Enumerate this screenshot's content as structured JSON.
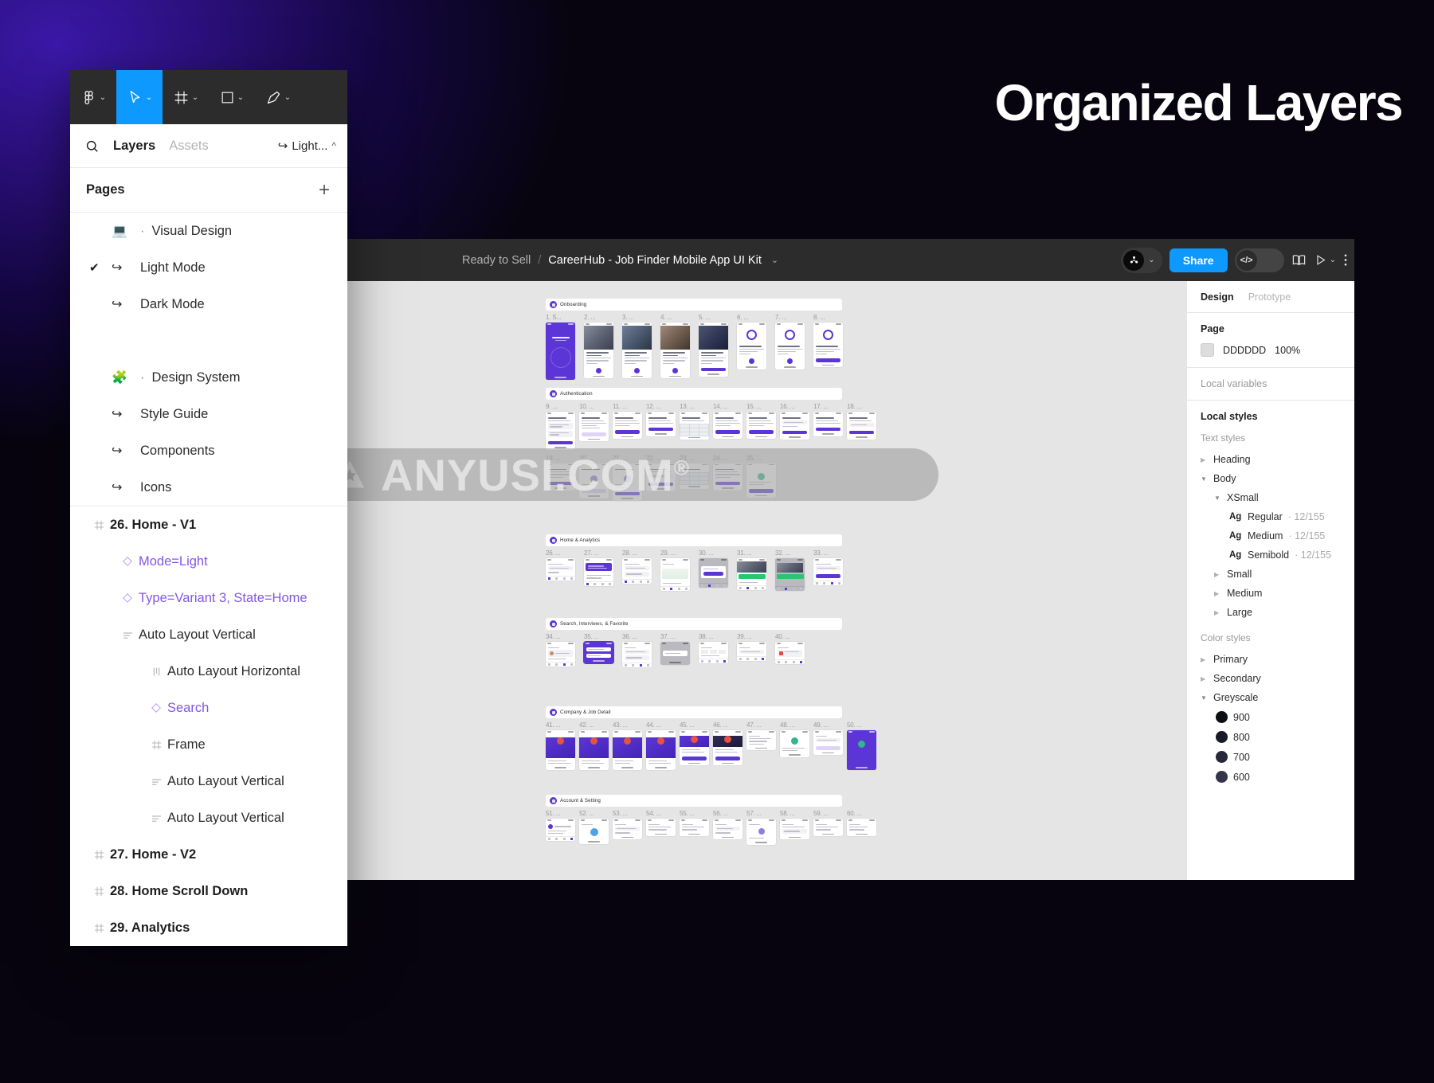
{
  "headline": "Organized Layers",
  "toolbar": {
    "tools": [
      {
        "name": "figma-menu",
        "glyph": "figma",
        "caret": true,
        "active": false
      },
      {
        "name": "move-tool",
        "glyph": "cursor",
        "caret": true,
        "active": true
      },
      {
        "name": "frame-tool",
        "glyph": "frame",
        "caret": true,
        "active": false
      },
      {
        "name": "shape-tool",
        "glyph": "square",
        "caret": true,
        "active": false
      },
      {
        "name": "pen-tool",
        "glyph": "pen",
        "caret": true,
        "active": false
      }
    ]
  },
  "left_panel": {
    "tabs": [
      {
        "label": "Layers",
        "active": true
      },
      {
        "label": "Assets",
        "active": false
      }
    ],
    "search_icon": "search-icon",
    "mode_selector": {
      "label": "Light...",
      "caret": "^"
    },
    "pages_header": {
      "title": "Pages",
      "add_label": "+"
    },
    "pages": [
      {
        "icon": "laptop",
        "dot": "·",
        "label": "Visual Design",
        "checked": false,
        "indent": 0
      },
      {
        "icon": "arrow",
        "label": "Light Mode",
        "checked": true,
        "indent": 1
      },
      {
        "icon": "arrow",
        "label": "Dark Mode",
        "checked": false,
        "indent": 1
      },
      {
        "icon": "puzzle",
        "dot": "·",
        "label": "Design System",
        "checked": false,
        "indent": 0,
        "spacer_before": true
      },
      {
        "icon": "arrow",
        "label": "Style Guide",
        "checked": false,
        "indent": 1
      },
      {
        "icon": "arrow",
        "label": "Components",
        "checked": false,
        "indent": 1
      },
      {
        "icon": "arrow",
        "label": "Icons",
        "checked": false,
        "indent": 1
      }
    ],
    "layers": [
      {
        "label": "26. Home - V1",
        "type": "frame",
        "indent": 0
      },
      {
        "label": "Mode=Light",
        "type": "comp",
        "indent": 1
      },
      {
        "label": "Type=Variant 3, State=Home",
        "type": "comp",
        "indent": 1
      },
      {
        "label": "Auto Layout Vertical",
        "type": "autov",
        "indent": 1
      },
      {
        "label": "Auto Layout Horizontal",
        "type": "autoh",
        "indent": 2
      },
      {
        "label": "Search",
        "type": "comp",
        "indent": 2
      },
      {
        "label": "Frame",
        "type": "frame-sub",
        "indent": 2
      },
      {
        "label": "Auto Layout Vertical",
        "type": "autov",
        "indent": 2
      },
      {
        "label": "Auto Layout Vertical",
        "type": "autov",
        "indent": 2
      },
      {
        "label": "27. Home - V2",
        "type": "frame",
        "indent": 0
      },
      {
        "label": "28. Home Scroll Down",
        "type": "frame",
        "indent": 0
      },
      {
        "label": "29. Analytics",
        "type": "frame",
        "indent": 0
      }
    ]
  },
  "editor": {
    "breadcrumb": {
      "project": "Ready to Sell",
      "separator": "/",
      "file": "CareerHub - Job Finder Mobile App UI Kit",
      "caret": "⌄"
    },
    "actions": {
      "avatar_caret": "⌄",
      "share_label": "Share",
      "code_label": "</>",
      "book_icon": "book-icon",
      "present_icon": "play-icon",
      "present_caret": "⌄"
    }
  },
  "canvas": {
    "sections": [
      {
        "label": "Onboarding",
        "frames": [
          "1. S...",
          "2. ...",
          "3. ...",
          "4. ...",
          "5. ...",
          "6. ...",
          "7. ...",
          "8. ..."
        ]
      },
      {
        "label": "Authentication",
        "frames": [
          "9. ...",
          "10. ...",
          "11. ...",
          "12. ...",
          "13. ...",
          "14. ...",
          "15. ...",
          "16. ...",
          "17. ...",
          "18. ..."
        ],
        "frames2": [
          "19. ...",
          "20. ...",
          "21. ...",
          "22. ...",
          "23. ...",
          "24. ...",
          "25. ..."
        ]
      },
      {
        "label": "Home & Analytics",
        "frames": [
          "26. ...",
          "27. ...",
          "28. ...",
          "29. ...",
          "30. ...",
          "31. ...",
          "32. ...",
          "33. ..."
        ]
      },
      {
        "label": "Search, Interviews, & Favorite",
        "frames": [
          "34. ...",
          "35. ...",
          "36. ...",
          "37. ...",
          "38. ...",
          "39. ...",
          "40. ..."
        ]
      },
      {
        "label": "Company & Job Detail",
        "frames": [
          "41. ...",
          "42. ...",
          "43. ...",
          "44. ...",
          "45. ...",
          "46. ...",
          "47. ...",
          "48. ...",
          "49. ...",
          "50. ..."
        ]
      },
      {
        "label": "Account & Setting",
        "frames": [
          "51. ...",
          "52. ...",
          "53. ...",
          "54. ...",
          "55. ...",
          "56. ...",
          "57. ...",
          "58. ...",
          "59. ...",
          "60. ..."
        ]
      }
    ]
  },
  "right_panel": {
    "tabs": [
      {
        "label": "Design",
        "active": true
      },
      {
        "label": "Prototype",
        "active": false
      }
    ],
    "page_section": {
      "title": "Page",
      "color_hex": "DDDDDD",
      "opacity": "100%",
      "swatch_color": "#dddddd"
    },
    "local_variables_label": "Local variables",
    "local_styles_label": "Local styles",
    "text_styles_label": "Text styles",
    "text_styles": [
      {
        "label": "Heading",
        "indent": 0,
        "state": "collapsed"
      },
      {
        "label": "Body",
        "indent": 0,
        "state": "expanded"
      },
      {
        "label": "XSmall",
        "indent": 1,
        "state": "expanded"
      },
      {
        "label": "Regular",
        "meta": "· 12/155",
        "indent": 2,
        "state": "leaf",
        "prefix": "Ag"
      },
      {
        "label": "Medium",
        "meta": "· 12/155",
        "indent": 2,
        "state": "leaf",
        "prefix": "Ag"
      },
      {
        "label": "Semibold",
        "meta": "· 12/155",
        "indent": 2,
        "state": "leaf",
        "prefix": "Ag"
      },
      {
        "label": "Small",
        "indent": 1,
        "state": "collapsed"
      },
      {
        "label": "Medium",
        "indent": 1,
        "state": "collapsed"
      },
      {
        "label": "Large",
        "indent": 1,
        "state": "collapsed"
      }
    ],
    "color_styles_label": "Color styles",
    "color_styles": [
      {
        "label": "Primary",
        "indent": 0,
        "state": "collapsed"
      },
      {
        "label": "Secondary",
        "indent": 0,
        "state": "collapsed"
      },
      {
        "label": "Greyscale",
        "indent": 0,
        "state": "expanded"
      },
      {
        "label": "900",
        "indent": 1,
        "state": "swatch",
        "color": "#0d0d14"
      },
      {
        "label": "800",
        "indent": 1,
        "state": "swatch",
        "color": "#1a1a26"
      },
      {
        "label": "700",
        "indent": 1,
        "state": "swatch",
        "color": "#282838"
      },
      {
        "label": "600",
        "indent": 1,
        "state": "swatch",
        "color": "#35354a"
      }
    ]
  },
  "watermark": {
    "text": "ANYUSI.COM",
    "registered": "®",
    "mark": "star-badge-icon"
  },
  "colors": {
    "figma_blue": "#0d99ff",
    "brand_purple": "#5b35d5",
    "component_purple": "#8257e5"
  }
}
